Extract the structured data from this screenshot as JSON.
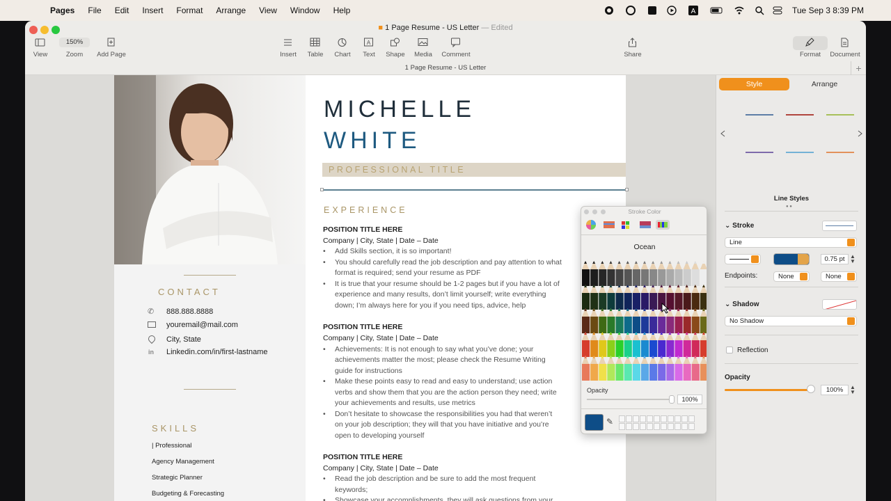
{
  "menubar": {
    "app": "Pages",
    "items": [
      "File",
      "Edit",
      "Insert",
      "Format",
      "Arrange",
      "View",
      "Window",
      "Help"
    ],
    "clock": "Tue Sep 3  8:39 PM"
  },
  "window": {
    "title": "1 Page Resume - US Letter",
    "edited": "— Edited",
    "subtitle": "1 Page Resume - US Letter"
  },
  "toolbar": {
    "view": "View",
    "zoom_value": "150%",
    "zoom": "Zoom",
    "add_page": "Add Page",
    "insert": "Insert",
    "table": "Table",
    "chart": "Chart",
    "text": "Text",
    "shape": "Shape",
    "media": "Media",
    "comment": "Comment",
    "share": "Share",
    "format": "Format",
    "document": "Document"
  },
  "resume": {
    "first": "MICHELLE",
    "last": "WHITE",
    "title": "PROFESSIONAL TITLE",
    "contact_h": "CONTACT",
    "phone": "888.888.8888",
    "email": "youremail@mail.com",
    "location": "City, State",
    "linkedin": "Linkedin.com/in/first-lastname",
    "skills_h": "SKILLS",
    "skills": [
      "| Professional",
      "Agency Management",
      "Strategic Planner",
      "Budgeting & Forecasting"
    ],
    "exp_h": "EXPERIENCE",
    "jobs": [
      {
        "pos": "POSITION TITLE HERE",
        "company": "Company | City, State | Date – Date",
        "b": [
          "Add Skills section, it is so important!",
          "You should carefully read the job description and pay attention to what",
          "format is required; send your resume as PDF",
          "It is true that your resume should be 1-2 pages but if you have a lot of",
          "experience and many results, don’t limit yourself; write everything",
          "down; I’m always here for you if you need tips, advice, help"
        ]
      },
      {
        "pos": "POSITION TITLE HERE",
        "company": "Company | City, State | Date – Date",
        "b": [
          "Achievements: It is not enough to say what you’ve done; your",
          "achievements matter the most; please check the Resume Writing",
          "guide for instructions",
          "Make these points easy to read and easy to understand; use action",
          "verbs and show them that you are the action person they need; write",
          "your achievements and results, use metrics",
          "Don’t hesitate to showcase the responsibilities you had that weren’t",
          "on your job description; they will that you have initiative and you’re",
          "open to developing yourself"
        ]
      },
      {
        "pos": "POSITION TITLE HERE",
        "company": "Company | City, State | Date – Date",
        "b": [
          "Read the job description and be sure to add the most frequent",
          "keywords;",
          "Showcase your accomplishments, they will ask questions from your"
        ]
      }
    ]
  },
  "colorpanel": {
    "title": "Stroke Color",
    "palette": "Ocean",
    "opacity_label": "Opacity",
    "opacity": "100%",
    "current_color": "#0e4d87"
  },
  "inspector": {
    "tab_style": "Style",
    "tab_arrange": "Arrange",
    "line_styles": "Line Styles",
    "stroke": "Stroke",
    "stroke_type": "Line",
    "stroke_width": "0.75 pt",
    "endpoints": "Endpoints:",
    "end_left": "None",
    "end_right": "None",
    "shadow": "Shadow",
    "shadow_value": "No Shadow",
    "reflection": "Reflection",
    "opacity": "Opacity",
    "opacity_value": "100%",
    "opacity_level": 1.0
  }
}
